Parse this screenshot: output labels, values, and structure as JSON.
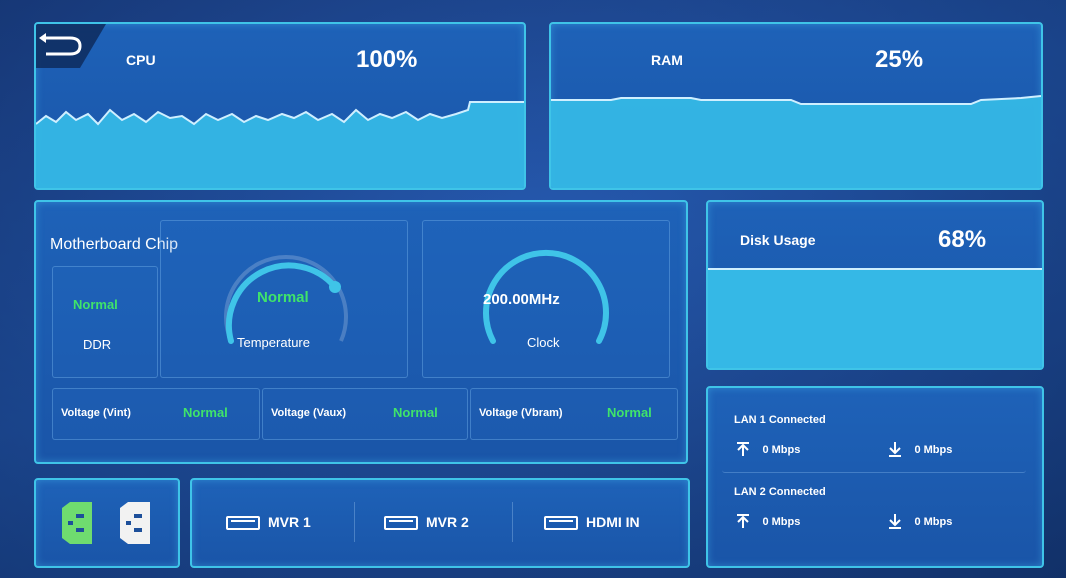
{
  "cpu": {
    "label": "CPU",
    "value": "100%"
  },
  "ram": {
    "label": "RAM",
    "value": "25%"
  },
  "motherboard": {
    "title": "Motherboard Chip",
    "ddr": {
      "status": "Normal",
      "label": "DDR"
    },
    "temperature": {
      "status": "Normal",
      "label": "Temperature"
    },
    "clock": {
      "value": "200.00MHz",
      "label": "Clock"
    },
    "voltages": [
      {
        "label": "Voltage (Vint)",
        "status": "Normal"
      },
      {
        "label": "Voltage (Vaux)",
        "status": "Normal"
      },
      {
        "label": "Voltage (Vbram)",
        "status": "Normal"
      }
    ]
  },
  "disk": {
    "label": "Disk Usage",
    "value": "68%",
    "fill": 0.68
  },
  "lan": [
    {
      "title": "LAN 1 Connected",
      "up": "0 Mbps",
      "down": "0 Mbps"
    },
    {
      "title": "LAN 2 Connected",
      "up": "0 Mbps",
      "down": "0 Mbps"
    }
  ],
  "ports": [
    "MVR 1",
    "MVR 2",
    "HDMI IN"
  ],
  "colors": {
    "accent": "#3fc4e8",
    "status_ok": "#3fe46a",
    "panel": "#1e62b8",
    "power_active": "#6fdc6f"
  },
  "icons": {
    "back": "back-arrow-icon",
    "power_on": "power-socket-icon",
    "power_off": "power-socket-icon",
    "hdmi": "hdmi-port-icon",
    "upload": "upload-arrow-icon",
    "download": "download-arrow-icon"
  }
}
